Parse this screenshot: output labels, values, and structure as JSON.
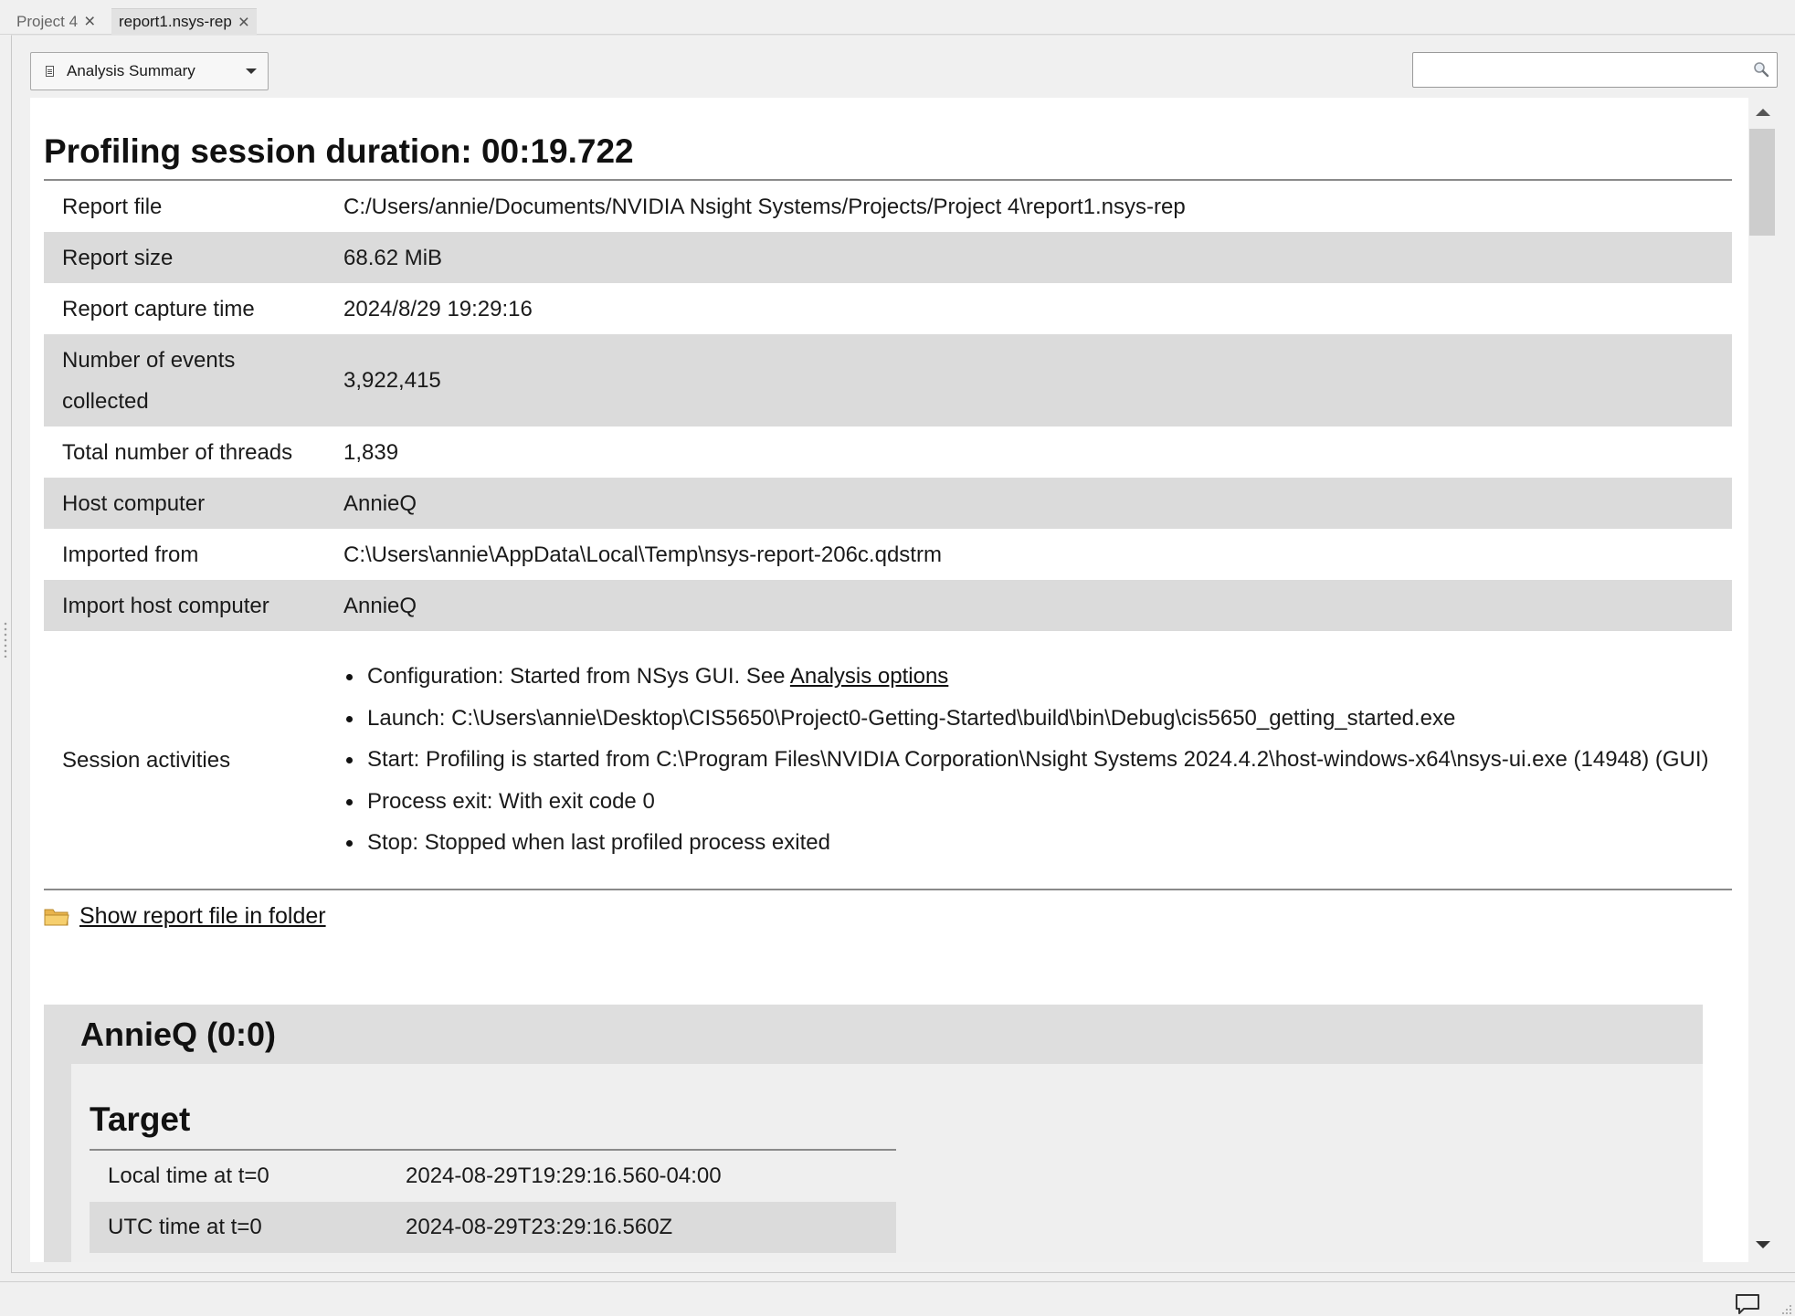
{
  "tabs": [
    {
      "label": "Project 4",
      "active": false
    },
    {
      "label": "report1.nsys-rep",
      "active": true
    }
  ],
  "toolbar": {
    "view_select": "Analysis Summary",
    "search": {
      "value": "",
      "placeholder": ""
    }
  },
  "summary": {
    "title": "Profiling session duration: 00:19.722",
    "rows": [
      {
        "key": "Report file",
        "value": "C:/Users/annie/Documents/NVIDIA Nsight Systems/Projects/Project 4\\report1.nsys-rep"
      },
      {
        "key": "Report size",
        "value": "68.62 MiB"
      },
      {
        "key": "Report capture time",
        "value": "2024/8/29 19:29:16"
      },
      {
        "key": "Number of events collected",
        "value": "3,922,415"
      },
      {
        "key": "Total number of threads",
        "value": "1,839"
      },
      {
        "key": "Host computer",
        "value": "AnnieQ"
      },
      {
        "key": "Imported from",
        "value": "C:\\Users\\annie\\AppData\\Local\\Temp\\nsys-report-206c.qdstrm"
      },
      {
        "key": "Import host computer",
        "value": "AnnieQ"
      }
    ],
    "session_activities": {
      "key": "Session activities",
      "configuration": {
        "text": "Configuration: Started from NSys GUI. See ",
        "link": "Analysis options"
      },
      "items": [
        "Launch: C:\\Users\\annie\\Desktop\\CIS5650\\Project0-Getting-Started\\build\\bin\\Debug\\cis5650_getting_started.exe",
        "Start: Profiling is started from C:\\Program Files\\NVIDIA Corporation\\Nsight Systems 2024.4.2\\host-windows-x64\\nsys-ui.exe (14948) (GUI)",
        "Process exit: With exit code 0",
        "Stop: Stopped when last profiled process exited"
      ]
    },
    "show_folder_link": "Show report file in folder"
  },
  "host": {
    "title": "AnnieQ (0:0)",
    "target": {
      "title": "Target",
      "rows": [
        {
          "key": "Local time at t=0",
          "value": "2024-08-29T19:29:16.560-04:00"
        },
        {
          "key": "UTC time at t=0",
          "value": "2024-08-29T23:29:16.560Z"
        }
      ]
    }
  },
  "icons": {
    "tab_close": "close-icon",
    "view_select": "document-icon",
    "dropdown": "chevron-down-icon",
    "search": "search-icon",
    "folder": "folder-icon",
    "status_chat": "chat-bubble-icon"
  }
}
